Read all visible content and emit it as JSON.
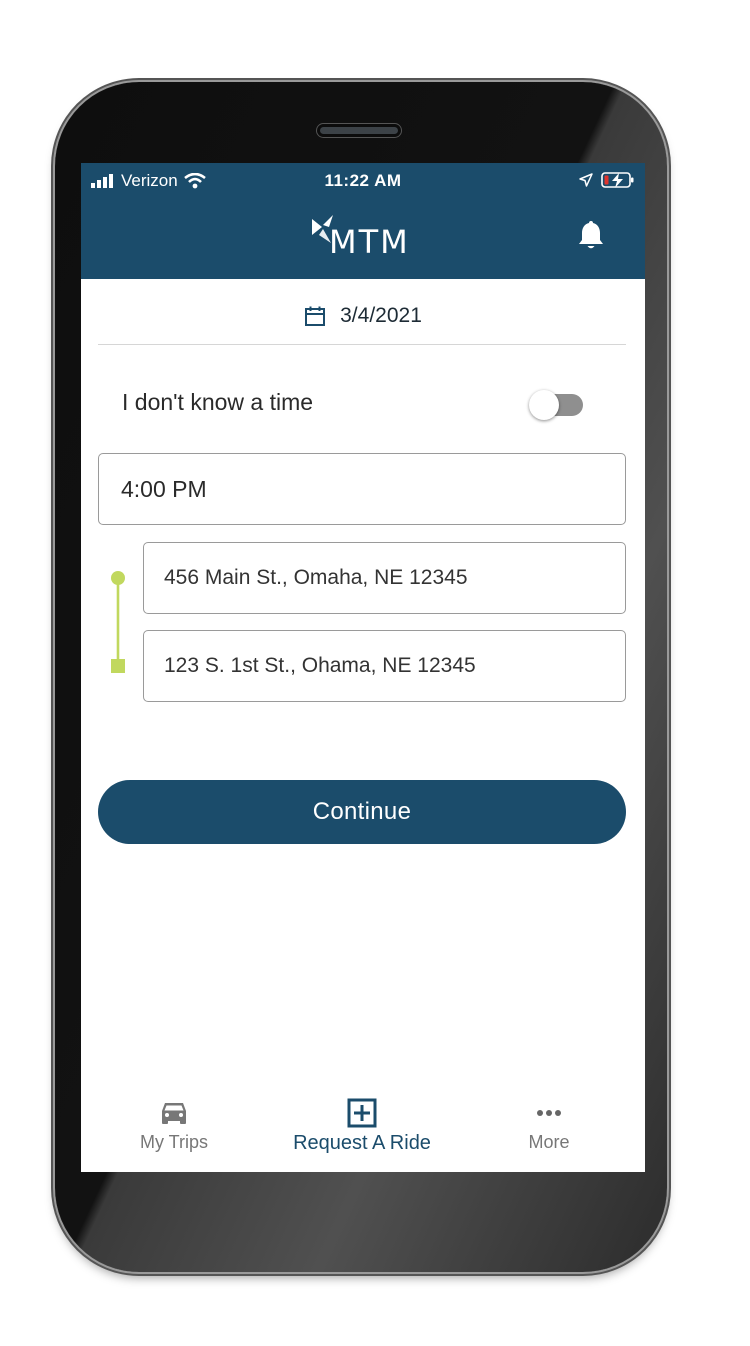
{
  "status_bar": {
    "carrier": "Verizon",
    "time": "11:22 AM"
  },
  "header": {
    "logo_text": "MTM",
    "bell_icon": "bell-icon"
  },
  "date": {
    "value": "3/4/2021",
    "icon": "calendar-icon"
  },
  "time_toggle": {
    "label": "I don't know a time",
    "enabled": false
  },
  "time_field": {
    "value": "4:00 PM"
  },
  "pickup": {
    "value": "456 Main St., Omaha, NE 12345"
  },
  "dropoff": {
    "value": "123 S. 1st St., Ohama, NE 12345"
  },
  "continue_button": {
    "label": "Continue"
  },
  "bottom_nav": {
    "items": [
      {
        "label": "My Trips",
        "icon": "car-icon",
        "active": false
      },
      {
        "label": "Request A Ride",
        "icon": "plus-square-icon",
        "active": true
      },
      {
        "label": "More",
        "icon": "more-dots-icon",
        "active": false
      }
    ]
  },
  "colors": {
    "brand": "#1b4c6b",
    "route_accent": "#c1d85e",
    "battery_low": "#e0342c"
  }
}
